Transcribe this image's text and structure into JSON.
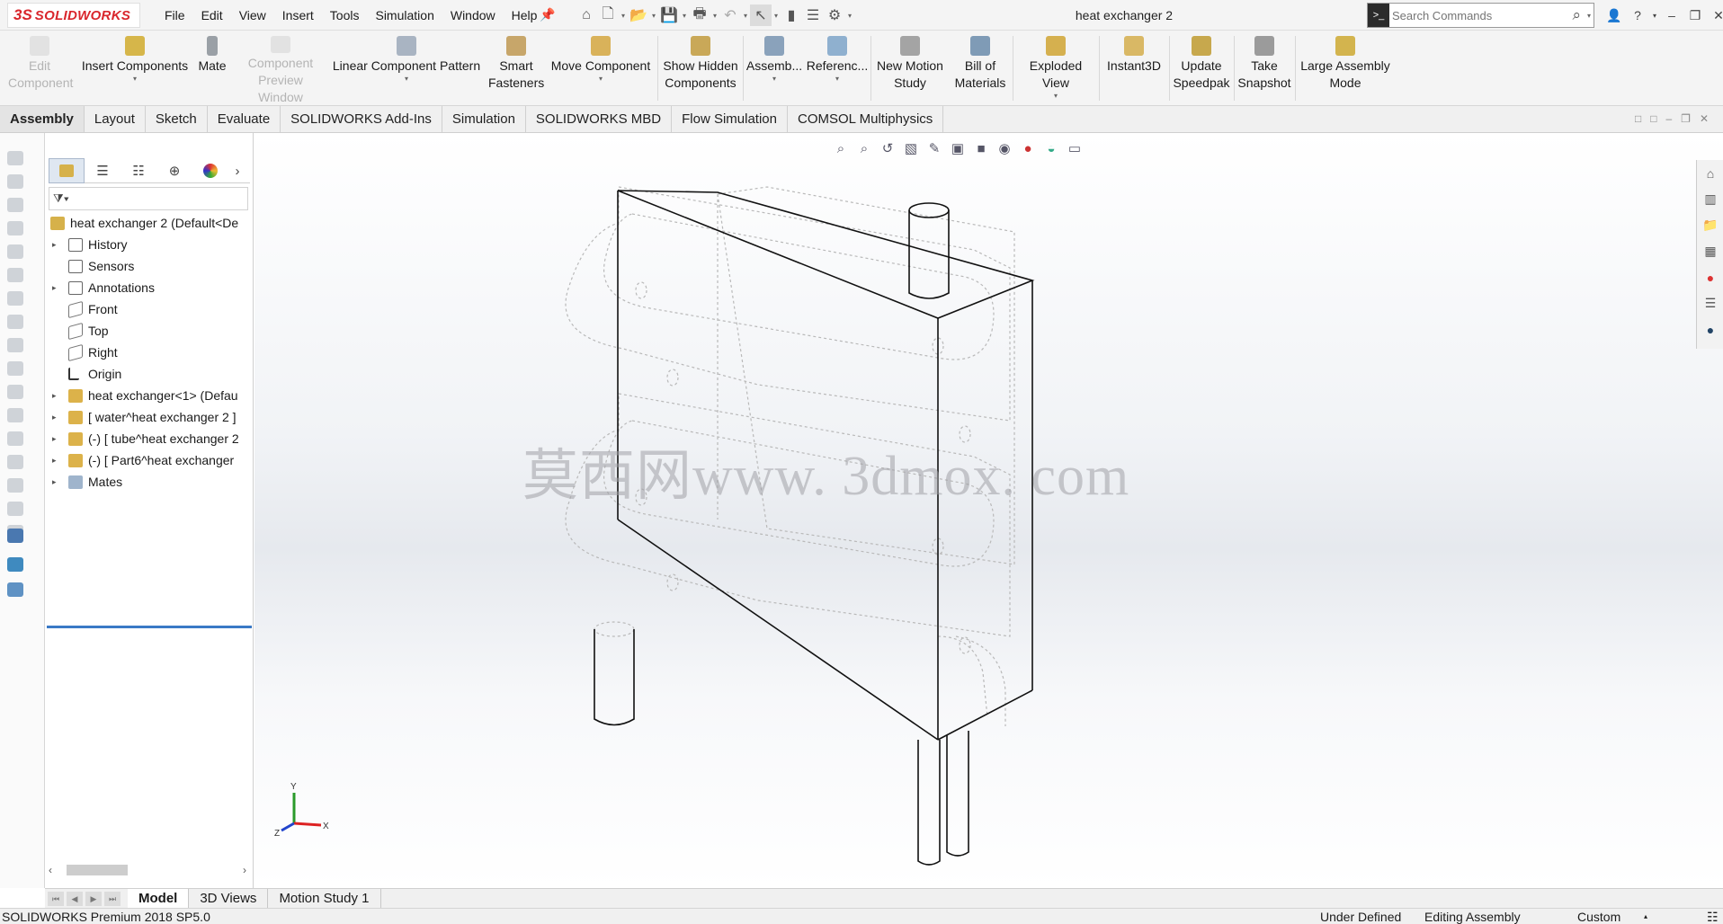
{
  "app": {
    "brand_ds": "3S",
    "brand_name": "SOLIDWORKS",
    "document_title": "heat exchanger 2",
    "menu": [
      "File",
      "Edit",
      "View",
      "Insert",
      "Tools",
      "Simulation",
      "Window",
      "Help"
    ],
    "search_placeholder": "Search Commands",
    "accent_color": "#d9262c"
  },
  "commands": [
    {
      "label": "Edit Component",
      "disabled": true
    },
    {
      "label": "Insert Components",
      "disabled": false
    },
    {
      "label": "Mate",
      "disabled": false
    },
    {
      "label": "Component Preview Window",
      "disabled": true
    },
    {
      "label": "Linear Component Pattern",
      "disabled": false
    },
    {
      "label": "Smart Fasteners",
      "disabled": false
    },
    {
      "label": "Move Component",
      "disabled": false
    },
    {
      "label": "Show Hidden Components",
      "disabled": false
    },
    {
      "label": "Assemb...",
      "disabled": false
    },
    {
      "label": "Referenc...",
      "disabled": false
    },
    {
      "label": "New Motion Study",
      "disabled": false
    },
    {
      "label": "Bill of Materials",
      "disabled": false
    },
    {
      "label": "Exploded View",
      "disabled": false
    },
    {
      "label": "Instant3D",
      "disabled": false
    },
    {
      "label": "Update Speedpak",
      "disabled": false
    },
    {
      "label": "Take Snapshot",
      "disabled": false
    },
    {
      "label": "Large Assembly Mode",
      "disabled": false
    }
  ],
  "tabs": [
    "Assembly",
    "Layout",
    "Sketch",
    "Evaluate",
    "SOLIDWORKS Add-Ins",
    "Simulation",
    "SOLIDWORKS MBD",
    "Flow Simulation",
    "COMSOL Multiphysics"
  ],
  "active_tab": "Assembly",
  "tree": {
    "root": "heat exchanger 2  (Default<De",
    "items": [
      {
        "label": "History",
        "icon": "history-icon",
        "expandable": true
      },
      {
        "label": "Sensors",
        "icon": "sensors-icon",
        "expandable": false
      },
      {
        "label": "Annotations",
        "icon": "annotations-icon",
        "expandable": true
      },
      {
        "label": "Front",
        "icon": "plane-icon",
        "expandable": false
      },
      {
        "label": "Top",
        "icon": "plane-icon",
        "expandable": false
      },
      {
        "label": "Right",
        "icon": "plane-icon",
        "expandable": false
      },
      {
        "label": "Origin",
        "icon": "origin-icon",
        "expandable": false
      },
      {
        "label": "heat exchanger<1> (Defau",
        "icon": "part-icon",
        "expandable": true
      },
      {
        "label": "[ water^heat exchanger 2 ]",
        "icon": "part-icon",
        "expandable": true
      },
      {
        "label": "(-) [ tube^heat exchanger 2",
        "icon": "part-icon",
        "expandable": true
      },
      {
        "label": "(-) [ Part6^heat exchanger",
        "icon": "part-icon",
        "expandable": true
      },
      {
        "label": "Mates",
        "icon": "mates-icon",
        "expandable": true
      }
    ]
  },
  "bottom_tabs": [
    "Model",
    "3D Views",
    "Motion Study 1"
  ],
  "active_bottom_tab": "Model",
  "watermark": "莫西网www. 3dmox. com",
  "triad": {
    "x": "X",
    "y": "Y",
    "z": "Z"
  },
  "status": {
    "version": "SOLIDWORKS Premium 2018 SP5.0",
    "definition": "Under Defined",
    "mode": "Editing Assembly",
    "units": "Custom"
  }
}
